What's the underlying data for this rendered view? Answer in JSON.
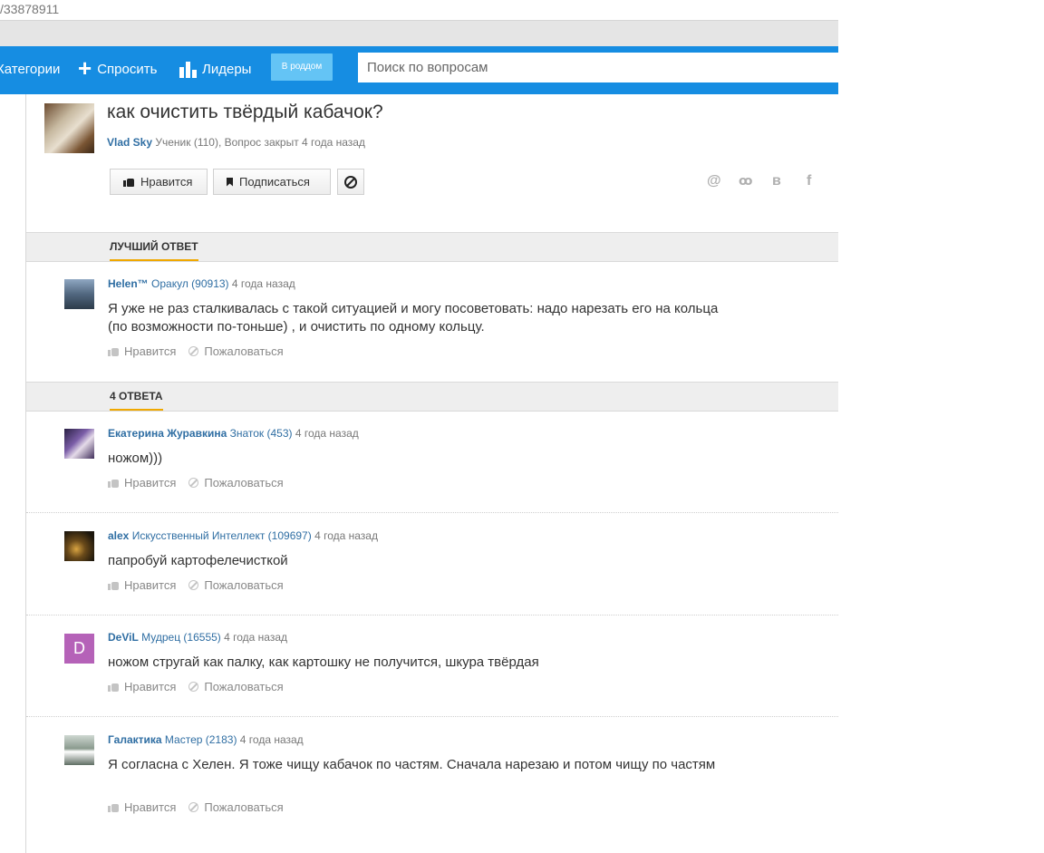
{
  "browser": {
    "url_fragment": "/33878911"
  },
  "nav": {
    "categories": "Категории",
    "ask": "Спросить",
    "leaders": "Лидеры",
    "badge": "В роддом",
    "search_placeholder": "Поиск по вопросам"
  },
  "question": {
    "title": "как очистить твёрдый кабачок?",
    "author": "Vlad Sky",
    "meta": "Ученик (110), Вопрос закрыт 4 года назад",
    "like_label": "Нравится",
    "subscribe_label": "Подписаться"
  },
  "share": [
    "@",
    "ok",
    "в",
    "f"
  ],
  "best_answer": {
    "section_label": "ЛУЧШИЙ ОТВЕТ",
    "author": "Helen™",
    "rank": "Оракул (90913)",
    "time": "4 года назад",
    "text": "Я уже не раз сталкивалась с такой ситуацией и могу посоветовать: надо нарезать его на кольца (по возможности по-тоньше) , и очистить по одному кольцу."
  },
  "answers_section_label": "4 ОТВЕТА",
  "actions": {
    "like": "Нравится",
    "report": "Пожаловаться"
  },
  "answers": [
    {
      "author": "Екатерина Журавкина",
      "rank": "Знаток (453)",
      "time": "4 года назад",
      "text": "ножом)))"
    },
    {
      "author": "alex",
      "rank": "Искусственный Интеллект (109697)",
      "time": "4 года назад",
      "text": "папробуй картофелечисткой"
    },
    {
      "author": "DeViL",
      "rank": "Мудрец (16555)",
      "time": "4 года назад",
      "text": "ножом стругай как палку, как картошку не получится, шкура твёрдая",
      "avatar_letter": "D"
    },
    {
      "author": "Галактика",
      "rank": "Мастер (2183)",
      "time": "4 года назад",
      "text": "Я согласна с Хелен. Я тоже чищу кабачок по частям. Сначала нарезаю и потом чищу по частям"
    }
  ]
}
